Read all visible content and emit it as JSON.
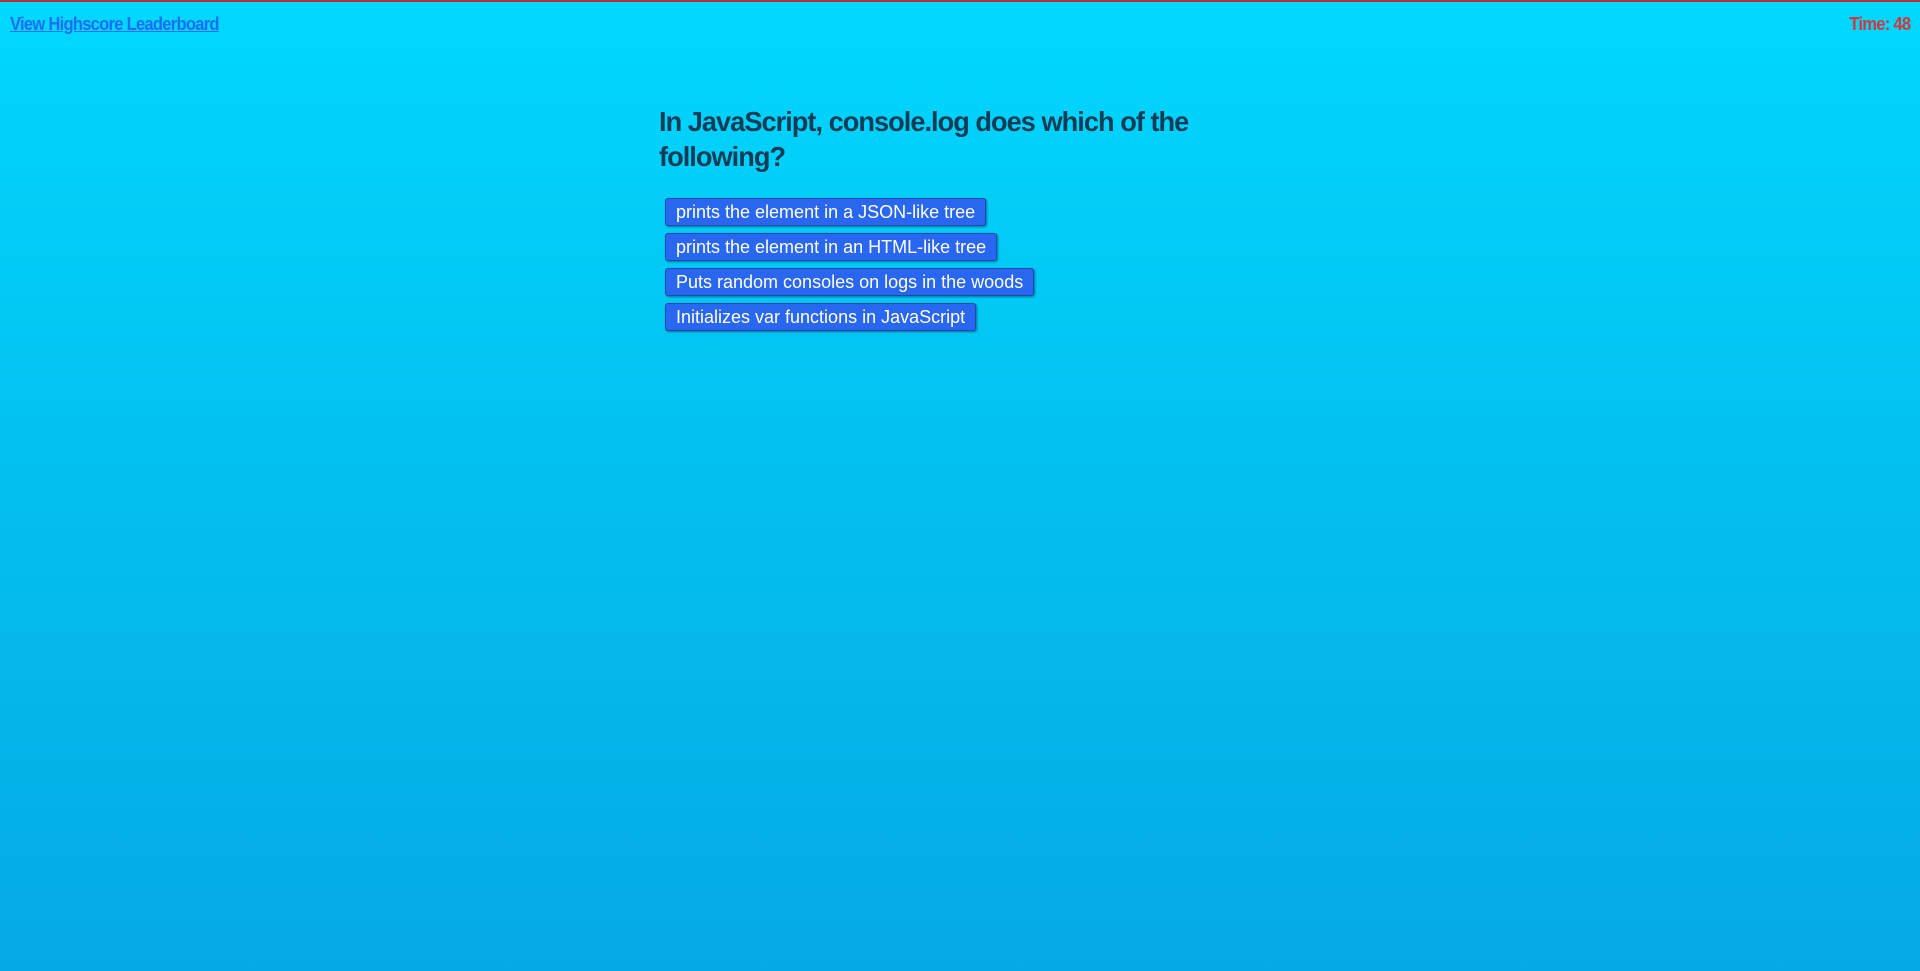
{
  "header": {
    "leaderboard_link": "View Highscore Leaderboard",
    "timer": "Time: 48"
  },
  "quiz": {
    "question": "In JavaScript, console.log does which of the following?",
    "choices": [
      "prints the element in a JSON-like tree",
      "prints the element in an HTML-like tree",
      "Puts random consoles on logs in the woods",
      "Initializes var functions in JavaScript"
    ]
  },
  "colors": {
    "background_top": "#00d8ff",
    "background_bottom": "#05a9e6",
    "link": "#1e6ef4",
    "timer": "#d5363d",
    "question_text": "#0d3c56",
    "button_bg": "#2a67f0",
    "button_text": "#ffffff"
  }
}
